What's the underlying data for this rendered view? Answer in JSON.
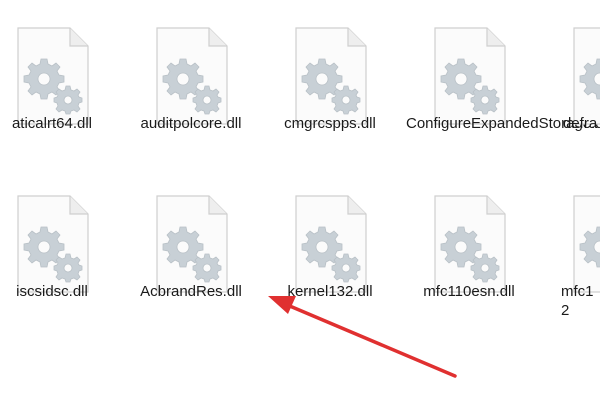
{
  "files": [
    {
      "name": "aticalrt64.dll",
      "icon": "dll-file-icon"
    },
    {
      "name": "auditpolcore.dll",
      "icon": "dll-file-icon"
    },
    {
      "name": "cmgrcspps.dll",
      "icon": "dll-file-icon"
    },
    {
      "name": "ConfigureExpandedStorage.dll",
      "icon": "dll-file-icon"
    },
    {
      "name": "defra",
      "icon": "dll-file-icon"
    },
    {
      "name": "iscsidsc.dll",
      "icon": "dll-file-icon"
    },
    {
      "name": "AcbrandRes.dll",
      "icon": "dll-file-icon"
    },
    {
      "name": "kernel132.dll",
      "icon": "dll-file-icon"
    },
    {
      "name": "mfc110esn.dll",
      "icon": "dll-file-icon"
    },
    {
      "name": "mfc12",
      "icon": "dll-file-icon"
    }
  ],
  "annotation": {
    "color": "#e03030"
  }
}
